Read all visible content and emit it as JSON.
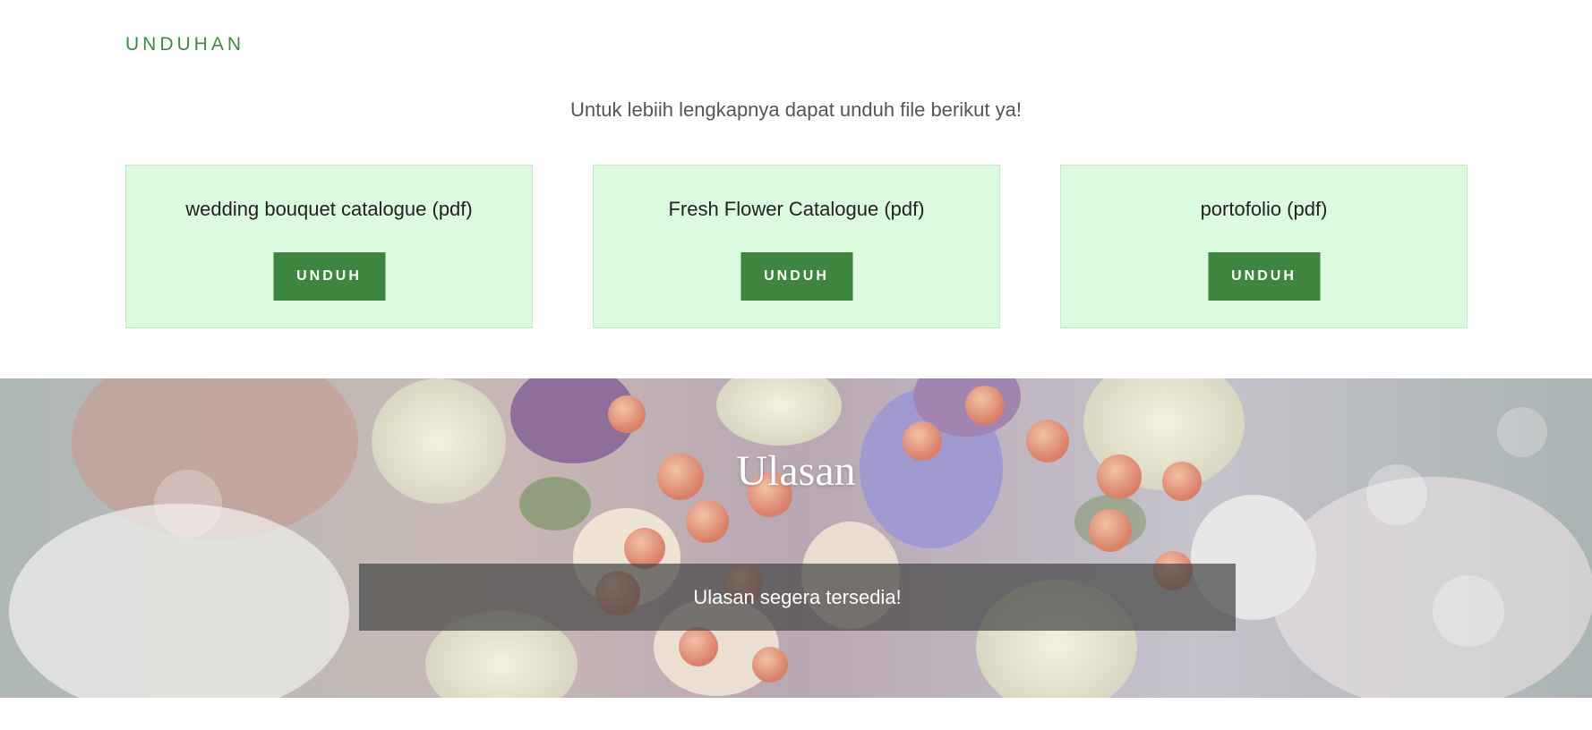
{
  "download_section": {
    "label": "UNDUHAN",
    "intro": "Untuk lebiih lengkapnya dapat unduh file berikut ya!",
    "cards": [
      {
        "title": "wedding bouquet catalogue (pdf)",
        "button": "UNDUH"
      },
      {
        "title": "Fresh Flower Catalogue (pdf)",
        "button": "UNDUH"
      },
      {
        "title": "portofolio (pdf)",
        "button": "UNDUH"
      }
    ]
  },
  "review_section": {
    "title": "Ulasan",
    "message": "Ulasan segera tersedia!"
  },
  "colors": {
    "accent_green": "#3e853f",
    "card_background": "#dcfadd",
    "label_green": "#3f8a3f"
  }
}
